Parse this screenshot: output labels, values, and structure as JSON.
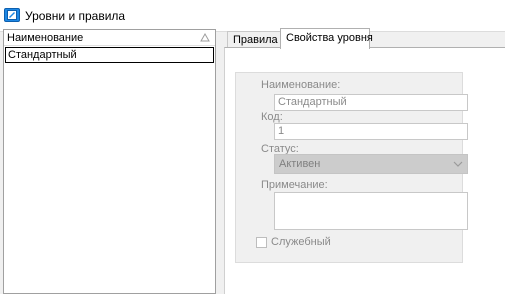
{
  "window": {
    "title": "Уровни и правила",
    "icon": "app-window-icon"
  },
  "list": {
    "column_header": "Наименование",
    "sort_icon": "sort-ascending-icon",
    "rows": [
      {
        "label": "Стандартный",
        "selected": true
      }
    ]
  },
  "tabs": [
    {
      "label": "Правила",
      "active": false
    },
    {
      "label": "Свойства уровня",
      "active": true
    }
  ],
  "form": {
    "name_label": "Наименование:",
    "name_value": "Стандартный",
    "code_label": "Код:",
    "code_value": "1",
    "status_label": "Статус:",
    "status_value": "Активен",
    "note_label": "Примечание:",
    "note_value": "",
    "service_label": "Служебный",
    "service_checked": false,
    "disabled": true
  },
  "colors": {
    "accent": "#1e88e5",
    "disabled_text": "#8a8a8a",
    "panel_bg": "#f0f0f0"
  }
}
